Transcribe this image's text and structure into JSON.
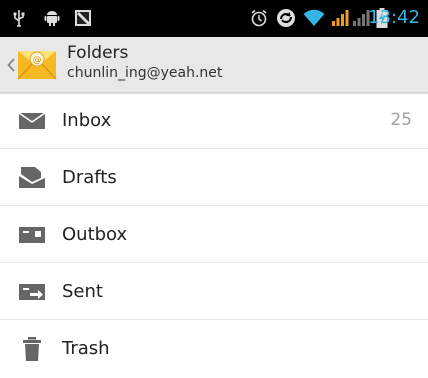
{
  "status_bar": {
    "time": "13:42",
    "icons": [
      "usb-icon",
      "android-debug-icon",
      "notification-image-icon",
      "alarm-icon",
      "sync-icon",
      "wifi-icon",
      "signal-icon",
      "signal-weak-icon",
      "battery-charging-icon"
    ],
    "accent_color": "#33b5e5"
  },
  "action_bar": {
    "title": "Folders",
    "subtitle": "chunlin_ing@yeah.net",
    "icons": [
      "up-caret-icon",
      "mail-app-icon"
    ]
  },
  "folders": [
    {
      "label": "Inbox",
      "count": "25",
      "icon": "inbox-icon"
    },
    {
      "label": "Drafts",
      "count": "",
      "icon": "drafts-icon"
    },
    {
      "label": "Outbox",
      "count": "",
      "icon": "outbox-icon"
    },
    {
      "label": "Sent",
      "count": "",
      "icon": "sent-icon"
    },
    {
      "label": "Trash",
      "count": "",
      "icon": "trash-icon"
    }
  ]
}
